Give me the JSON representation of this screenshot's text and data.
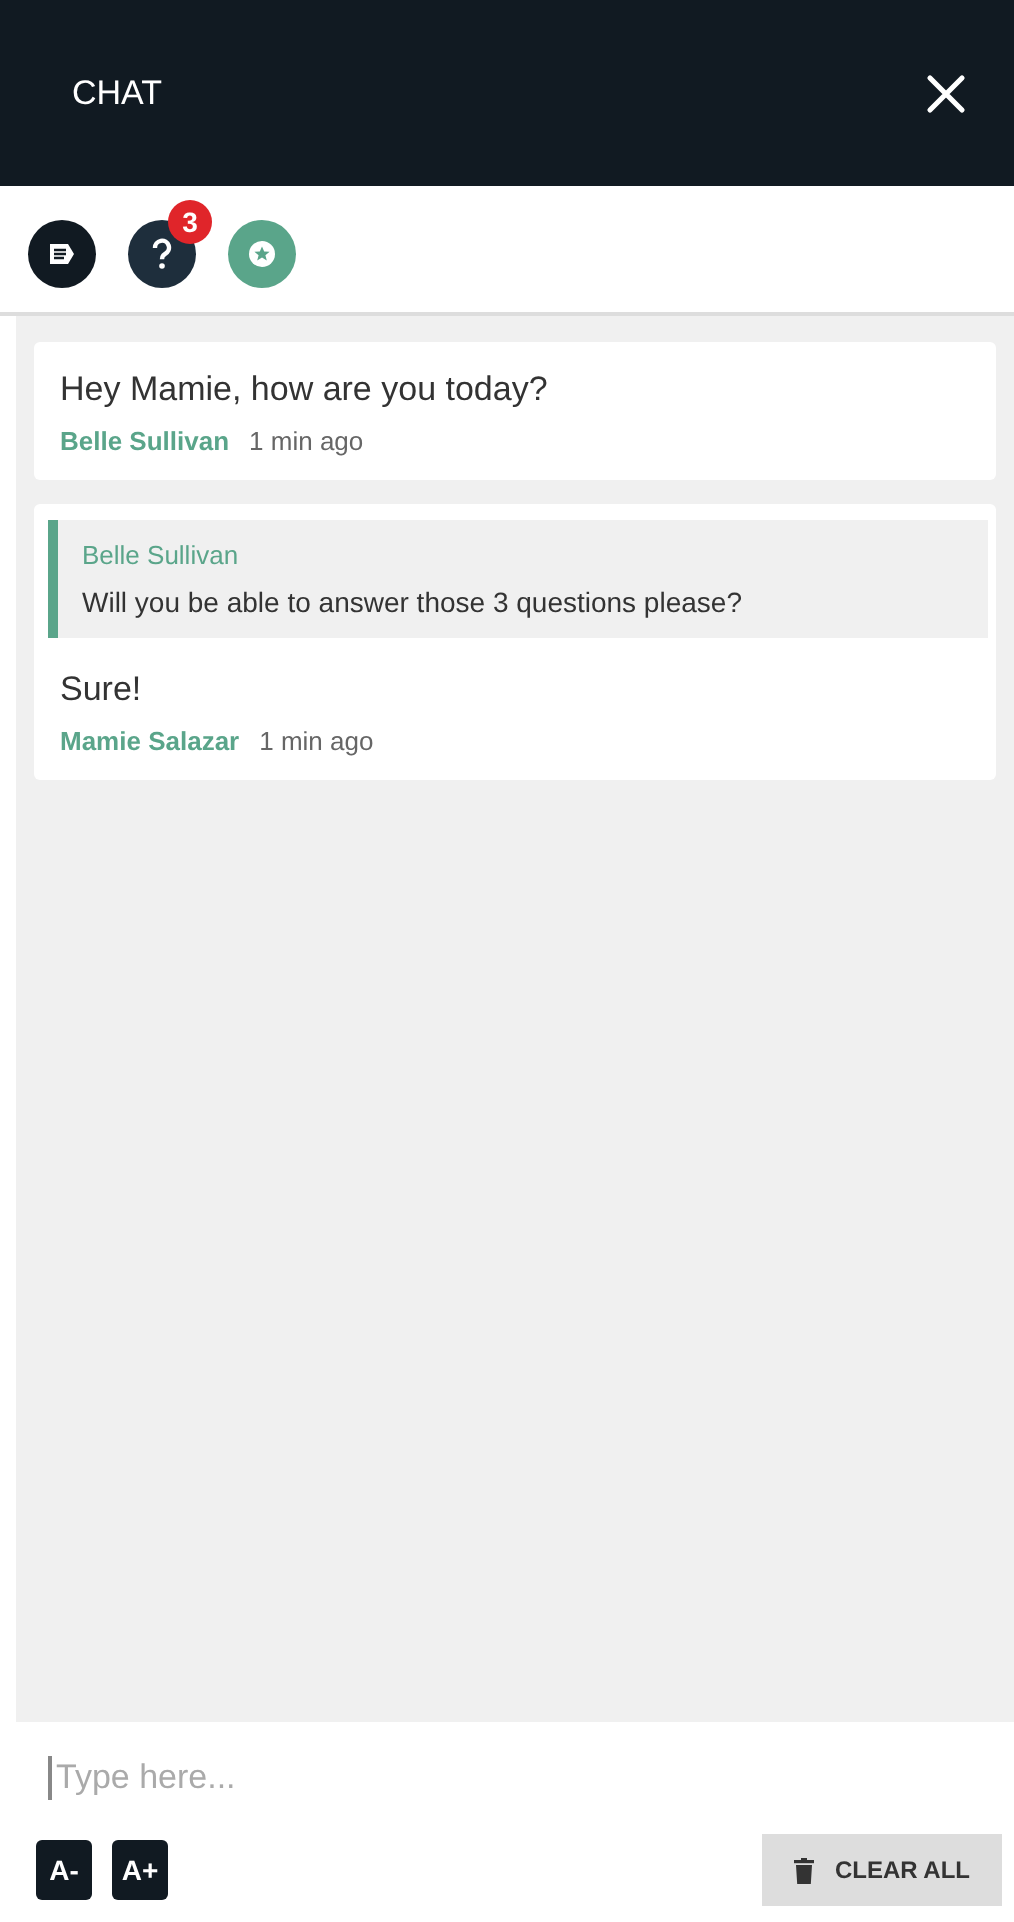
{
  "header": {
    "title": "CHAT"
  },
  "toolbar": [
    {
      "kind": "notes"
    },
    {
      "kind": "question",
      "badge": "3"
    },
    {
      "kind": "star"
    }
  ],
  "messages": [
    {
      "text": "Hey Mamie, how are you today?",
      "author": "Belle Sullivan",
      "time": "1 min ago"
    },
    {
      "quote": {
        "author": "Belle Sullivan",
        "text": "Will you be able to answer those 3 questions please?"
      },
      "text": "Sure!",
      "author": "Mamie Salazar",
      "time": "1 min ago"
    }
  ],
  "input": {
    "placeholder": "Type here..."
  },
  "footer": {
    "decrease": "A-",
    "increase": "A+",
    "clear": "CLEAR ALL"
  }
}
